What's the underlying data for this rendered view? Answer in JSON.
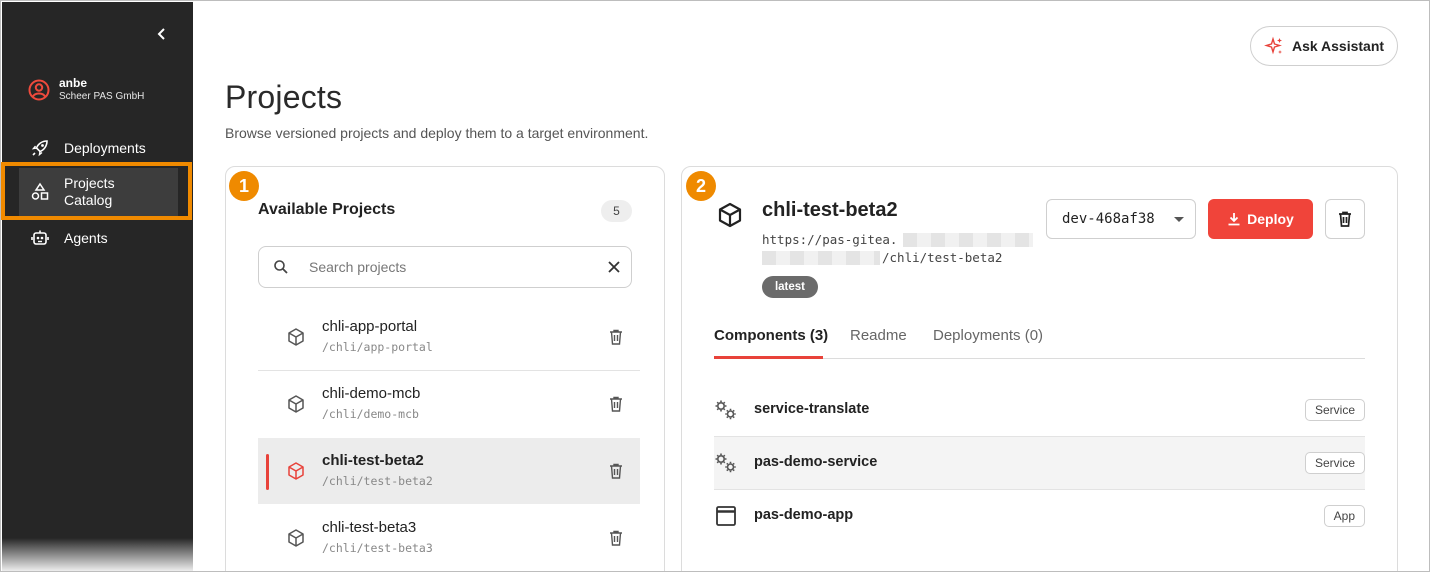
{
  "sidebar": {
    "user": {
      "name": "anbe",
      "org": "Scheer PAS GmbH"
    },
    "items": [
      {
        "label": "Deployments",
        "icon": "rocket-icon"
      },
      {
        "label": "Projects Catalog",
        "icon": "shapes-icon"
      },
      {
        "label": "Agents",
        "icon": "robot-icon"
      }
    ],
    "highlight_color": "#f08a00"
  },
  "header": {
    "assistant_label": "Ask Assistant",
    "title": "Projects",
    "subtitle": "Browse versioned projects and deploy them to a target environment."
  },
  "steps": [
    "1",
    "2"
  ],
  "projects": {
    "title": "Available Projects",
    "count": "5",
    "search_placeholder": "Search projects",
    "items": [
      {
        "name": "chli-app-portal",
        "path": "/chli/app-portal",
        "selected": false
      },
      {
        "name": "chli-demo-mcb",
        "path": "/chli/demo-mcb",
        "selected": false
      },
      {
        "name": "chli-test-beta2",
        "path": "/chli/test-beta2",
        "selected": true
      },
      {
        "name": "chli-test-beta3",
        "path": "/chli/test-beta3",
        "selected": false
      }
    ]
  },
  "detail": {
    "name": "chli-test-beta2",
    "url_line1": "https://pas-gitea.",
    "url_line2": "/chli/test-beta2",
    "tag": "latest",
    "version": "dev-468af38",
    "deploy_label": "Deploy",
    "tabs": [
      "Components (3)",
      "Readme",
      "Deployments (0)"
    ],
    "components": [
      {
        "name": "service-translate",
        "type": "Service",
        "icon": "gears-icon"
      },
      {
        "name": "pas-demo-service",
        "type": "Service",
        "icon": "gears-icon"
      },
      {
        "name": "pas-demo-app",
        "type": "App",
        "icon": "window-icon"
      }
    ]
  },
  "colors": {
    "accent": "#f0443a",
    "sidebar": "#262626",
    "step": "#ef8a00"
  }
}
